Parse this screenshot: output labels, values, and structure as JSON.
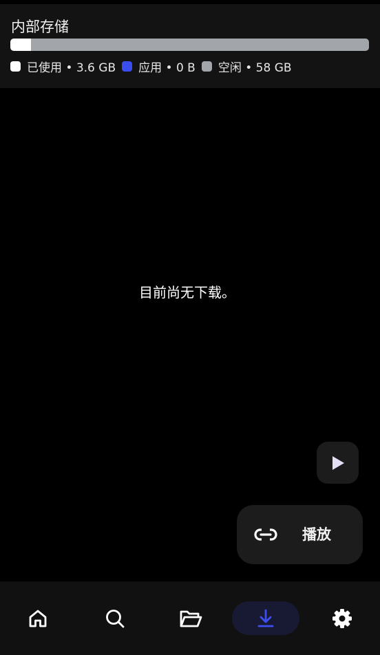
{
  "storage": {
    "title": "内部存储",
    "used_fraction": 0.058,
    "apps_fraction": 0.0,
    "legend": [
      {
        "label": "已使用 • 3.6 GB",
        "color": "#ffffff"
      },
      {
        "label": "应用 • 0 B",
        "color": "#3a4ef0"
      },
      {
        "label": "空闲 • 58 GB",
        "color": "#a2a6ab"
      }
    ]
  },
  "main": {
    "empty_message": "目前尚无下载。"
  },
  "fab": {
    "play_icon": "play-icon",
    "play_label": "播放",
    "link_icon": "link-icon"
  },
  "nav": {
    "items": [
      {
        "name": "home",
        "icon": "home-icon",
        "active": false
      },
      {
        "name": "search",
        "icon": "search-icon",
        "active": false
      },
      {
        "name": "folders",
        "icon": "folder-open-icon",
        "active": false
      },
      {
        "name": "downloads",
        "icon": "download-icon",
        "active": true
      },
      {
        "name": "settings",
        "icon": "gear-icon",
        "active": false
      }
    ],
    "active_color": "#3d4ff0",
    "inactive_color": "#ffffff"
  }
}
